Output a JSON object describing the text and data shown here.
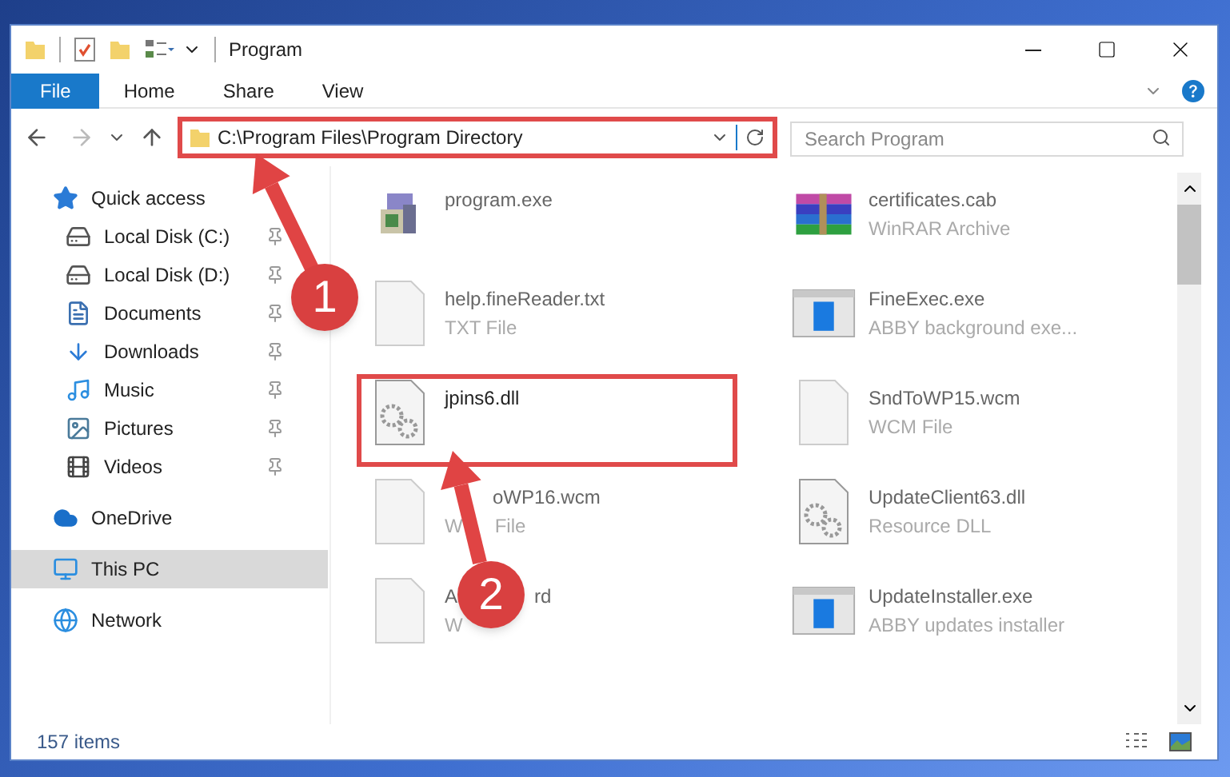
{
  "window": {
    "title": "Program"
  },
  "ribbon_tabs": [
    {
      "label": "File",
      "selected": true
    },
    {
      "label": "Home",
      "selected": false
    },
    {
      "label": "Share",
      "selected": false
    },
    {
      "label": "View",
      "selected": false
    }
  ],
  "address": {
    "value": "C:\\Program Files\\Program Directory",
    "highlighted": true
  },
  "search": {
    "placeholder": "Search Program"
  },
  "sidebar": {
    "items": [
      {
        "label": "Quick access",
        "pinned": false,
        "selected": false,
        "children": [
          {
            "label": "Local Disk (C:)",
            "pinned": true,
            "selected": false
          },
          {
            "label": "Local Disk (D:)",
            "pinned": true,
            "selected": false
          },
          {
            "label": "Documents",
            "pinned": true,
            "selected": false
          },
          {
            "label": "Downloads",
            "pinned": true,
            "selected": false
          },
          {
            "label": "Music",
            "pinned": true,
            "selected": false
          },
          {
            "label": "Pictures",
            "pinned": true,
            "selected": false
          },
          {
            "label": "Videos",
            "pinned": true,
            "selected": false
          }
        ]
      },
      {
        "label": "OneDrive",
        "pinned": false,
        "selected": false
      },
      {
        "label": "This PC",
        "pinned": false,
        "selected": true
      },
      {
        "label": "Network",
        "pinned": false,
        "selected": false
      }
    ]
  },
  "files": [
    {
      "name_parts": [
        "program.exe"
      ],
      "kind": "installer",
      "highlighted": false
    },
    {
      "name_parts": [
        "certificates.cab"
      ],
      "type_parts": [
        "WinRAR Archive"
      ],
      "kind": "archive",
      "highlighted": false
    },
    {
      "name_parts": [
        "help.fineReader.txt"
      ],
      "type_parts": [
        "TXT File"
      ],
      "kind": "blank",
      "highlighted": false
    },
    {
      "name_parts": [
        "FineExec.exe"
      ],
      "type_parts": [
        "ABBY background exe..."
      ],
      "kind": "app",
      "highlighted": false
    },
    {
      "name_parts": [
        "jpins6.dll"
      ],
      "kind": "dll",
      "highlighted": true
    },
    {
      "name_parts": [
        "SndToWP15.wcm"
      ],
      "type_parts": [
        "WCM File"
      ],
      "kind": "blank",
      "highlighted": false
    },
    {
      "name_parts": [
        "oWP16.wcm"
      ],
      "type_parts": [
        "W",
        "File"
      ],
      "kind": "blank",
      "highlighted": false
    },
    {
      "name_parts": [
        "UpdateClient63.dll"
      ],
      "type_parts": [
        "Resource DLL"
      ],
      "kind": "dll",
      "highlighted": false
    },
    {
      "name_parts": [
        "A",
        "rd"
      ],
      "type_parts": [
        "W"
      ],
      "kind": "blank",
      "highlighted": false
    },
    {
      "name_parts": [
        "UpdateInstaller.exe"
      ],
      "type_parts": [
        "ABBY updates installer"
      ],
      "kind": "app",
      "highlighted": false
    }
  ],
  "status_bar": {
    "count": "157 items"
  },
  "annotations": [
    {
      "label": "1"
    },
    {
      "label": "2"
    }
  ]
}
